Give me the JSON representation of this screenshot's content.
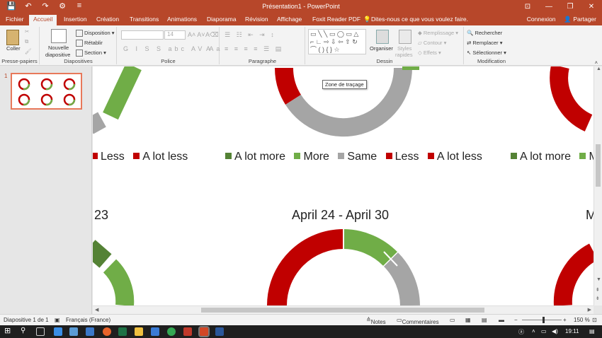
{
  "window": {
    "title": "Présentation1 - PowerPoint",
    "controls": [
      "⊡",
      "—",
      "❐",
      "✕"
    ]
  },
  "qat": [
    "💾",
    "↶",
    "↷",
    "⚙",
    "≡"
  ],
  "tabs": [
    "Fichier",
    "Accueil",
    "Insertion",
    "Création",
    "Transitions",
    "Animations",
    "Diaporama",
    "Révision",
    "Affichage",
    "Foxit Reader PDF"
  ],
  "tell_me": "Dites-nous ce que vous voulez faire.",
  "account": {
    "signin": "Connexion",
    "share": "Partager"
  },
  "ribbon": {
    "clipboard": {
      "paste": "Coller",
      "label": "Presse-papiers"
    },
    "slides": {
      "new": "Nouvelle",
      "new2": "diapositive",
      "layout": "Disposition",
      "reset": "Rétablir",
      "section": "Section",
      "label": "Diapositives"
    },
    "font": {
      "size": "14",
      "label": "Police"
    },
    "paragraph": {
      "label": "Paragraphe"
    },
    "drawing": {
      "arrange": "Organiser",
      "styles": "Styles",
      "styles2": "rapides",
      "fill": "Remplissage",
      "outline": "Contour",
      "effects": "Effets",
      "label": "Dessin"
    },
    "editing": {
      "find": "Rechercher",
      "replace": "Remplacer",
      "select": "Sélectionner",
      "label": "Modification"
    }
  },
  "thumbnail": {
    "number": "1"
  },
  "slide": {
    "legend_left": [
      "Less",
      "A lot less"
    ],
    "legend_mid": [
      "A lot more",
      "More",
      "Same",
      "Less",
      "A lot less"
    ],
    "legend_right": [
      "A lot more",
      "M"
    ],
    "title_left": "23",
    "title_mid": "April 24 - April 30",
    "title_right": "M",
    "tooltip": "Zone de traçage"
  },
  "colors": {
    "a_lot_more": "#548235",
    "more": "#70ad47",
    "same": "#a5a5a5",
    "less": "#c00000",
    "a_lot_less": "#c00000",
    "accent": "#b7472a"
  },
  "status": {
    "slide": "Diapositive 1 de 1",
    "language": "Français (France)",
    "notes": "Notes",
    "comments": "Commentaires",
    "zoom": "150 %"
  },
  "taskbar": {
    "time": "19:11"
  }
}
